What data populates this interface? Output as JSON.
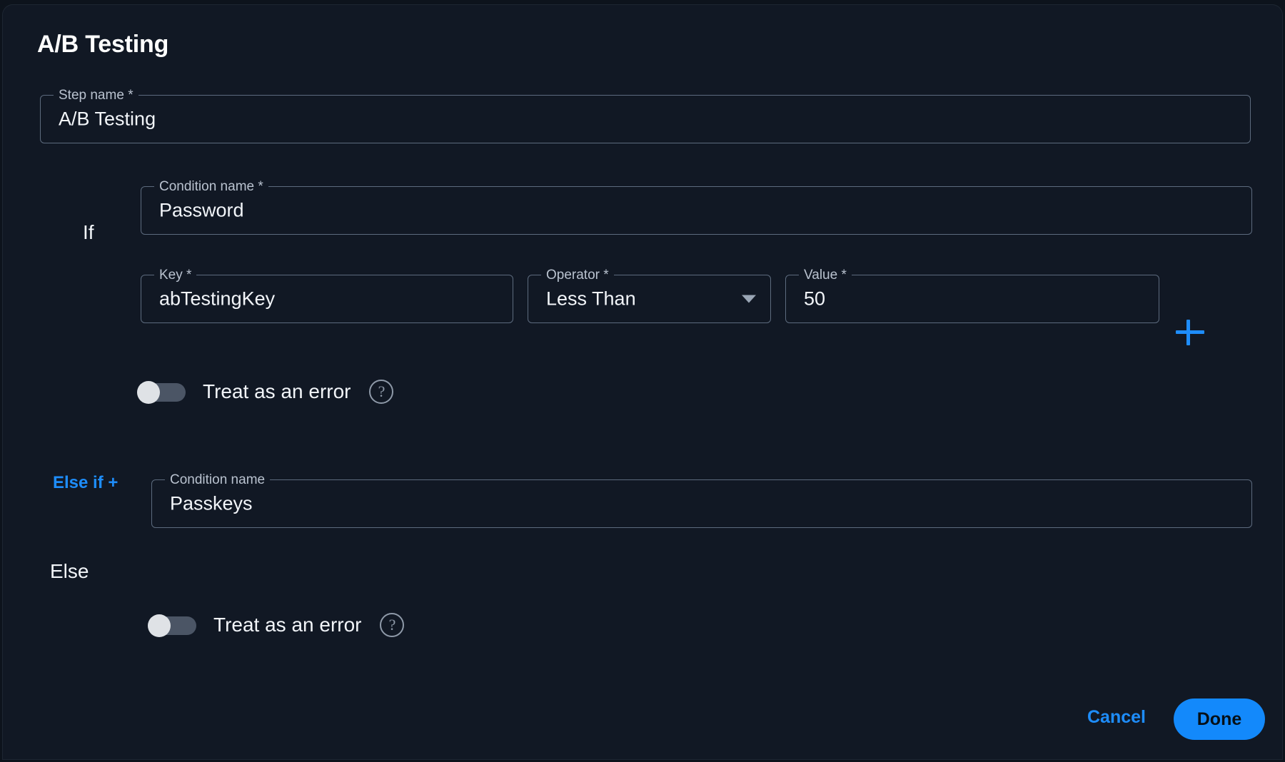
{
  "dialog": {
    "title": "A/B Testing"
  },
  "step_name": {
    "label": "Step name",
    "required_mark": "*",
    "value": "A/B Testing"
  },
  "if_branch": {
    "branch_label": "If",
    "condition_name": {
      "label": "Condition name",
      "required_mark": "*",
      "value": "Password"
    },
    "key": {
      "label": "Key",
      "required_mark": "*",
      "value": "abTestingKey"
    },
    "operator": {
      "label": "Operator",
      "required_mark": "*",
      "value": "Less Than",
      "icon": "chevron-down-icon"
    },
    "value_field": {
      "label": "Value",
      "required_mark": "*",
      "value": "50"
    },
    "add_condition": {
      "icon": "plus-icon"
    },
    "treat_as_error": {
      "label": "Treat as an error",
      "state": "off",
      "help_icon": "help-circle-icon",
      "help_glyph": "?"
    }
  },
  "else_if": {
    "label": "Else if +"
  },
  "else_branch": {
    "branch_label": "Else",
    "condition_name": {
      "label": "Condition name",
      "required_mark": "",
      "value": "Passkeys"
    },
    "treat_as_error": {
      "label": "Treat as an error",
      "state": "off",
      "help_icon": "help-circle-icon",
      "help_glyph": "?"
    }
  },
  "footer": {
    "cancel_label": "Cancel",
    "done_label": "Done"
  },
  "colors": {
    "background": "#111824",
    "accent_blue": "#1e8dfb",
    "done_button": "#1389fb",
    "field_border": "#5d6b7e",
    "label_text": "#b9c2cf",
    "value_text": "#f2f5f9"
  }
}
